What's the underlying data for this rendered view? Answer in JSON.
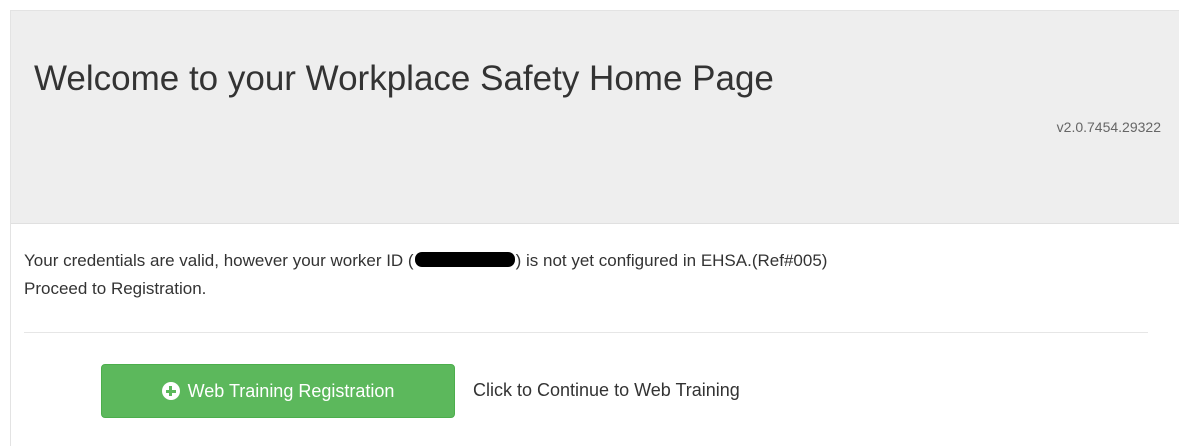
{
  "header": {
    "title": "Welcome to your Workplace Safety Home Page",
    "version": "v2.0.7454.29322"
  },
  "message": {
    "line1_before": "Your credentials are valid, however your worker ID (",
    "line1_after": ") is not yet configured in EHSA.(Ref#005)",
    "line2": "Proceed to Registration."
  },
  "action": {
    "icon": "plus-circle-icon",
    "button_label": "Web Training Registration",
    "hint": "Click to Continue to Web Training"
  },
  "colors": {
    "button_bg": "#5cb85c",
    "jumbotron_bg": "#eeeeee",
    "text": "#333333"
  }
}
